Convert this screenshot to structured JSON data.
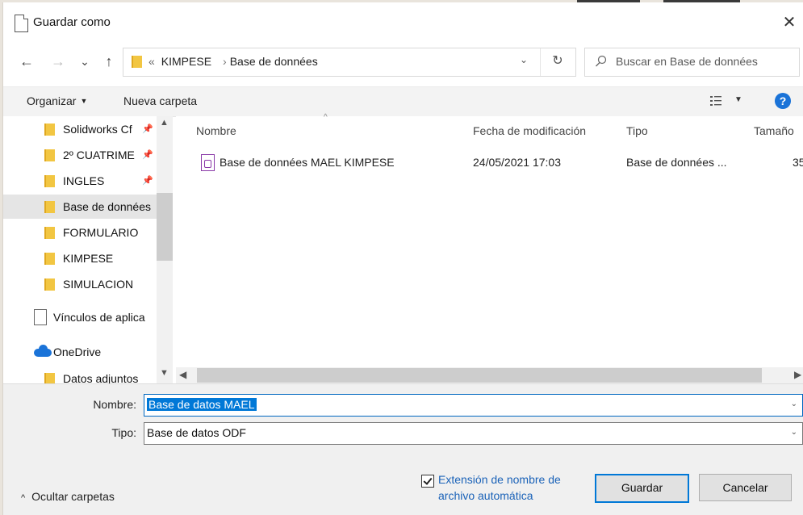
{
  "window": {
    "title": "Guardar como",
    "close": "✕"
  },
  "nav": {
    "back": "←",
    "forward": "→",
    "recent": "⌄",
    "up": "↑",
    "address": {
      "prefix": "«",
      "segments": [
        "KIMPESE",
        "Base de données"
      ],
      "separator": "›"
    },
    "dropdown": "⌄",
    "refresh": "↻",
    "search_placeholder": "Buscar en Base de données"
  },
  "toolbar": {
    "organize": "Organizar",
    "new_folder": "Nueva carpeta",
    "help": "?"
  },
  "sidebar": {
    "items": [
      {
        "label": "Solidworks Cf",
        "icon": "folder-icon",
        "pinned": true
      },
      {
        "label": "2º CUATRIME",
        "icon": "folder-icon",
        "pinned": true
      },
      {
        "label": "INGLES",
        "icon": "folder-icon",
        "pinned": true
      },
      {
        "label": "Base de données",
        "icon": "folder-icon",
        "selected": true
      },
      {
        "label": "FORMULARIO",
        "icon": "folder-icon"
      },
      {
        "label": "KIMPESE",
        "icon": "folder-icon"
      },
      {
        "label": "SIMULACION",
        "icon": "folder-icon"
      },
      {
        "label": "Vínculos de aplica",
        "icon": "document-icon"
      },
      {
        "label": "OneDrive",
        "icon": "cloud-icon"
      },
      {
        "label": "Datos adjuntos",
        "icon": "folder-icon"
      }
    ]
  },
  "files": {
    "columns": [
      "Nombre",
      "Fecha de modificación",
      "Tipo",
      "Tamaño"
    ],
    "rows": [
      {
        "name": "Base de données MAEL KIMPESE",
        "date": "24/05/2021 17:03",
        "type": "Base de données ...",
        "size": "35"
      }
    ]
  },
  "form": {
    "name_label": "Nombre:",
    "name_value": "Base de datos MAEL",
    "type_label": "Tipo:",
    "type_value": "Base de datos ODF",
    "auto_ext_line1": "Extensión de nombre de",
    "auto_ext_line2": "archivo automática",
    "auto_ext_checked": true,
    "save": "Guardar",
    "cancel": "Cancelar",
    "hide_folders": "Ocultar carpetas"
  },
  "colors": {
    "accent": "#0078d7",
    "folder": "#f2c642",
    "selection": "#e5e5e5",
    "link": "#1a62b8"
  }
}
